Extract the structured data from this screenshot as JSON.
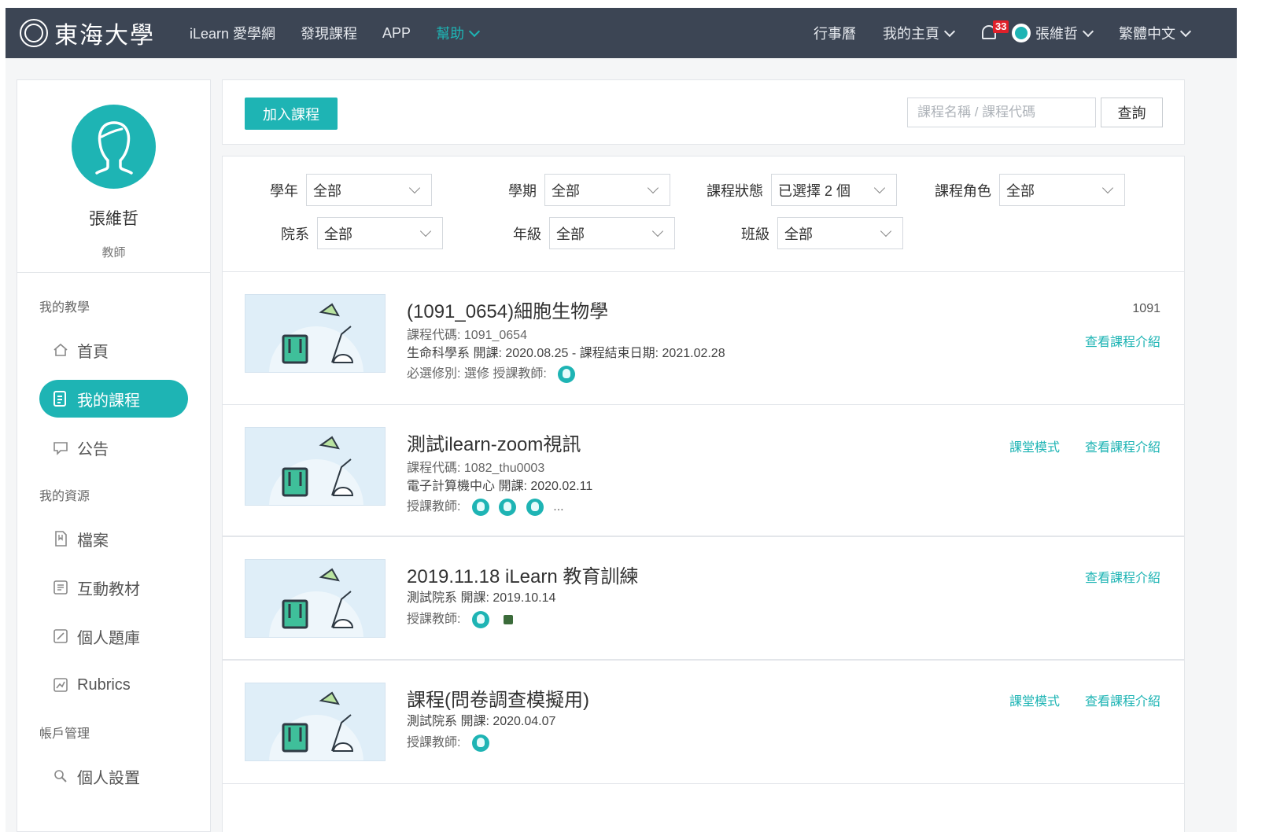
{
  "nav": {
    "logo_text": "東海大學",
    "items_left": [
      "iLearn 愛學網",
      "發現課程",
      "APP"
    ],
    "help_label": "幫助",
    "calendar": "行事曆",
    "my_home": "我的主頁",
    "notifications_count": "33",
    "user_name": "張維哲",
    "language": "繁體中文"
  },
  "sidebar": {
    "name": "張維哲",
    "role": "教師",
    "section_teaching": "我的教學",
    "home": "首頁",
    "my_courses": "我的課程",
    "announcements": "公告",
    "section_resources": "我的資源",
    "files": "檔案",
    "interactive": "互動教材",
    "question_bank": "個人題庫",
    "rubrics": "Rubrics",
    "section_account": "帳戶管理",
    "settings": "個人設置"
  },
  "toolbar": {
    "add_course": "加入課程",
    "search_placeholder": "課程名稱 / 課程代碼",
    "search_button": "查詢"
  },
  "filters": [
    {
      "label": "學年",
      "value": "全部"
    },
    {
      "label": "學期",
      "value": "全部"
    },
    {
      "label": "課程狀態",
      "value": "已選擇 2 個"
    },
    {
      "label": "課程角色",
      "value": "全部"
    },
    {
      "label": "院系",
      "value": "全部"
    },
    {
      "label": "年級",
      "value": "全部"
    },
    {
      "label": "班級",
      "value": "全部"
    }
  ],
  "courses": [
    {
      "title": "(1091_0654)細胞生物學",
      "code_line": "課程代碼: 1091_0654",
      "info_line": "生命科學系   開課: 2020.08.25   -  課程結束日期: 2021.02.28",
      "extra_line": "必選修別: 選修      授課教師:",
      "year": "1091",
      "link_intro": "查看課程介紹"
    },
    {
      "title": "測試ilearn-zoom視訊",
      "code_line": "課程代碼: 1082_thu0003",
      "info_line": "電子計算機中心   開課: 2020.02.11",
      "extra_line": "授課教師:",
      "more": "...",
      "link_mode": "課堂模式",
      "link_intro": "查看課程介紹"
    },
    {
      "title": "2019.11.18 iLearn 教育訓練",
      "info_line": "測試院系   開課: 2019.10.14",
      "extra_line": "授課教師:",
      "link_intro": "查看課程介紹"
    },
    {
      "title": "課程(問卷調查模擬用)",
      "info_line": "測試院系   開課: 2020.04.07",
      "extra_line": "授課教師:",
      "link_mode": "課堂模式",
      "link_intro": "查看課程介紹"
    }
  ],
  "colors": {
    "accent": "#1eb4b4",
    "nav_bg": "#3c4554",
    "badge": "#e0202a"
  }
}
